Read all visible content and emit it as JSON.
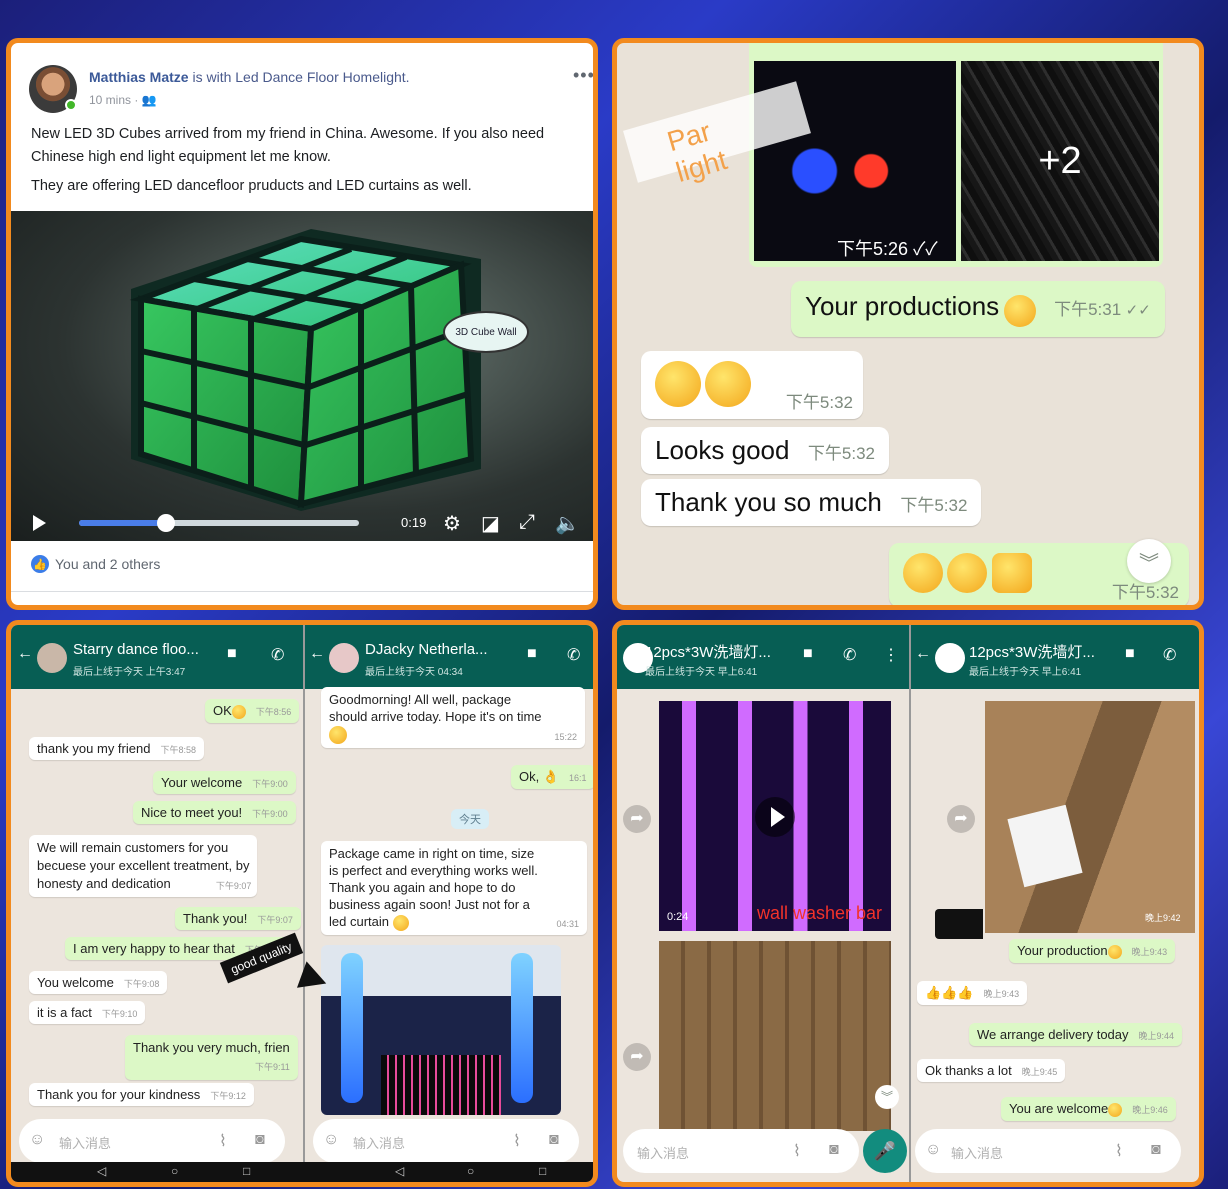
{
  "facebook": {
    "user": "Matthias Matze",
    "with_text": "is with Led Dance Floor Homelight.",
    "time": "10 mins ·",
    "more": "•••",
    "line1": "New LED 3D Cubes arrived from my friend in China. Awesome. If you also need Chinese high end light equipment let me know.",
    "line2": "They are offering LED dancefloor pruducts and LED curtains as well.",
    "tag": "3D Cube Wall",
    "video_time": "0:19",
    "reactions": "You and 2 others"
  },
  "chat1": {
    "images_more": "+2",
    "overlay_label": "Par light",
    "img_time": "下午5:26",
    "m1": "Your productions",
    "m1_ts": "下午5:31",
    "m2_ts": "下午5:32",
    "m3": "Looks good",
    "m3_ts": "下午5:32",
    "m4": "Thank you so much",
    "m4_ts": "下午5:32",
    "m5_ts": "下午5:32"
  },
  "chat2": {
    "left_name": "Starry dance floo...",
    "left_sub": "最后上线于今天 上午3:47",
    "right_name": "DJacky Netherla...",
    "right_sub": "最后上线于今天 04:34",
    "left_msgs": [
      {
        "t": "OK",
        "ts": "下午8:56"
      },
      {
        "t": "thank you my friend",
        "ts": "下午8:58"
      },
      {
        "t": "Your welcome",
        "ts": "下午9:00"
      },
      {
        "t": "Nice to meet you!",
        "ts": "下午9:00"
      },
      {
        "t": "We will remain customers for you",
        "t2": "becuese your excellent treatment, by",
        "t3": "honesty and dedication",
        "ts": "下午9:07"
      },
      {
        "t": "Thank you!",
        "ts": "下午9:07"
      },
      {
        "t": "I am very happy to hear that",
        "ts": "下午9:07"
      },
      {
        "t": "You welcome",
        "ts": "下午9:08"
      },
      {
        "t": "it is a fact",
        "ts": "下午9:10"
      },
      {
        "t": "Thank you very much, frien",
        "ts": "下午9:11"
      },
      {
        "t": "Thank you for your kindness",
        "ts": "下午9:12"
      }
    ],
    "r1a": "Goodmorning! All well, package",
    "r1b": "should arrive today. Hope it's on time",
    "r1_ts": "15:22",
    "r2": "Ok,",
    "r2_ts": "16:1",
    "today": "今天",
    "r3a": "Package came in right on time, size",
    "r3b": "is perfect and everything works well.",
    "r3c": "Thank you again and hope to do",
    "r3d": "business again soon! Just not for a",
    "r3e": "led curtain",
    "r3_ts": "04:31",
    "arrow_label": "good quality",
    "input_ph": "输入消息"
  },
  "chat3": {
    "left_name": "12pcs*3W洗墙灯...",
    "left_sub": "最后上线于今天 早上6:41",
    "right_name": "12pcs*3W洗墙灯...",
    "right_sub": "最后上线于今天 早上6:41",
    "video_dur": "0:24",
    "img_label": "wall washer bar",
    "img_ts": "晚上9:42",
    "r_img_ts": "晚上9:42",
    "m1": "Your production",
    "m1_ts": "晚上9:43",
    "m2_ts": "晚上9:43",
    "m3": "We arrange delivery today",
    "m3_ts": "晚上9:44",
    "m4": "Ok thanks a lot",
    "m4_ts": "晚上9:45",
    "m5": "You are welcome",
    "m5_ts": "晚上9:46",
    "input_ph": "输入消息"
  },
  "colors": {
    "frame": "#f28a1e",
    "wa_green": "#075e54",
    "out_bubble": "#dcf8c6",
    "fb_blue": "#3b5998"
  }
}
